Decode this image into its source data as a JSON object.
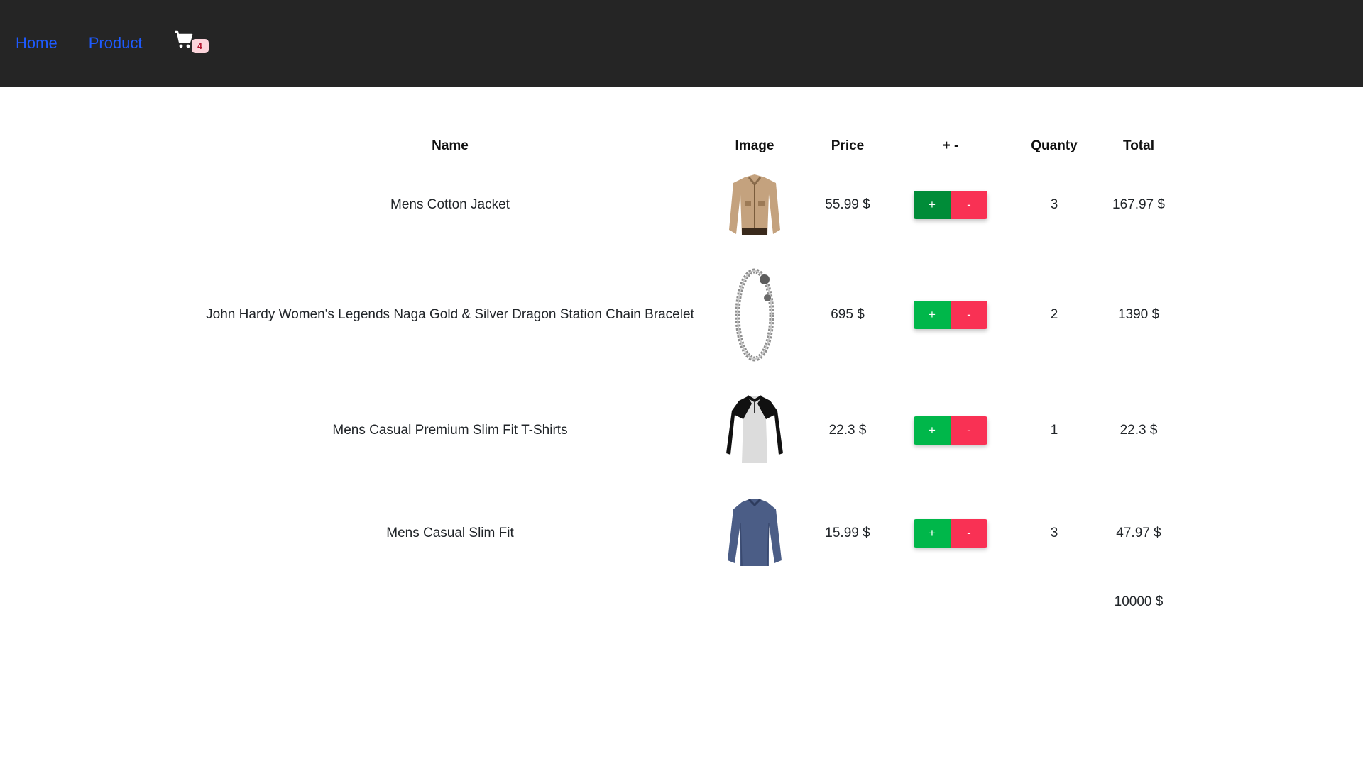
{
  "nav": {
    "links": [
      "Home",
      "Product"
    ],
    "cart_count": "4"
  },
  "table": {
    "headers": [
      "Name",
      "Image",
      "Price",
      "+ -",
      "Quanty",
      "Total"
    ],
    "rows": [
      {
        "name": "Mens Cotton Jacket",
        "image": "jacket",
        "price": "55.99 $",
        "plus": "+",
        "minus": "-",
        "quantity": "3",
        "total": "167.97 $"
      },
      {
        "name": "John Hardy Women's Legends Naga Gold & Silver Dragon Station Chain Bracelet",
        "image": "bracelet",
        "price": "695 $",
        "plus": "+",
        "minus": "-",
        "quantity": "2",
        "total": "1390 $"
      },
      {
        "name": "Mens Casual Premium Slim Fit T-Shirts",
        "image": "raglan-shirt",
        "price": "22.3 $",
        "plus": "+",
        "minus": "-",
        "quantity": "1",
        "total": "22.3 $"
      },
      {
        "name": "Mens Casual Slim Fit",
        "image": "long-sleeve-shirt",
        "price": "15.99 $",
        "plus": "+",
        "minus": "-",
        "quantity": "3",
        "total": "47.97 $"
      }
    ],
    "grand_total": "10000 $"
  },
  "colors": {
    "navbar": "#252525",
    "link": "#1e5bff",
    "plus": "#00b74a",
    "minus": "#f93154"
  }
}
